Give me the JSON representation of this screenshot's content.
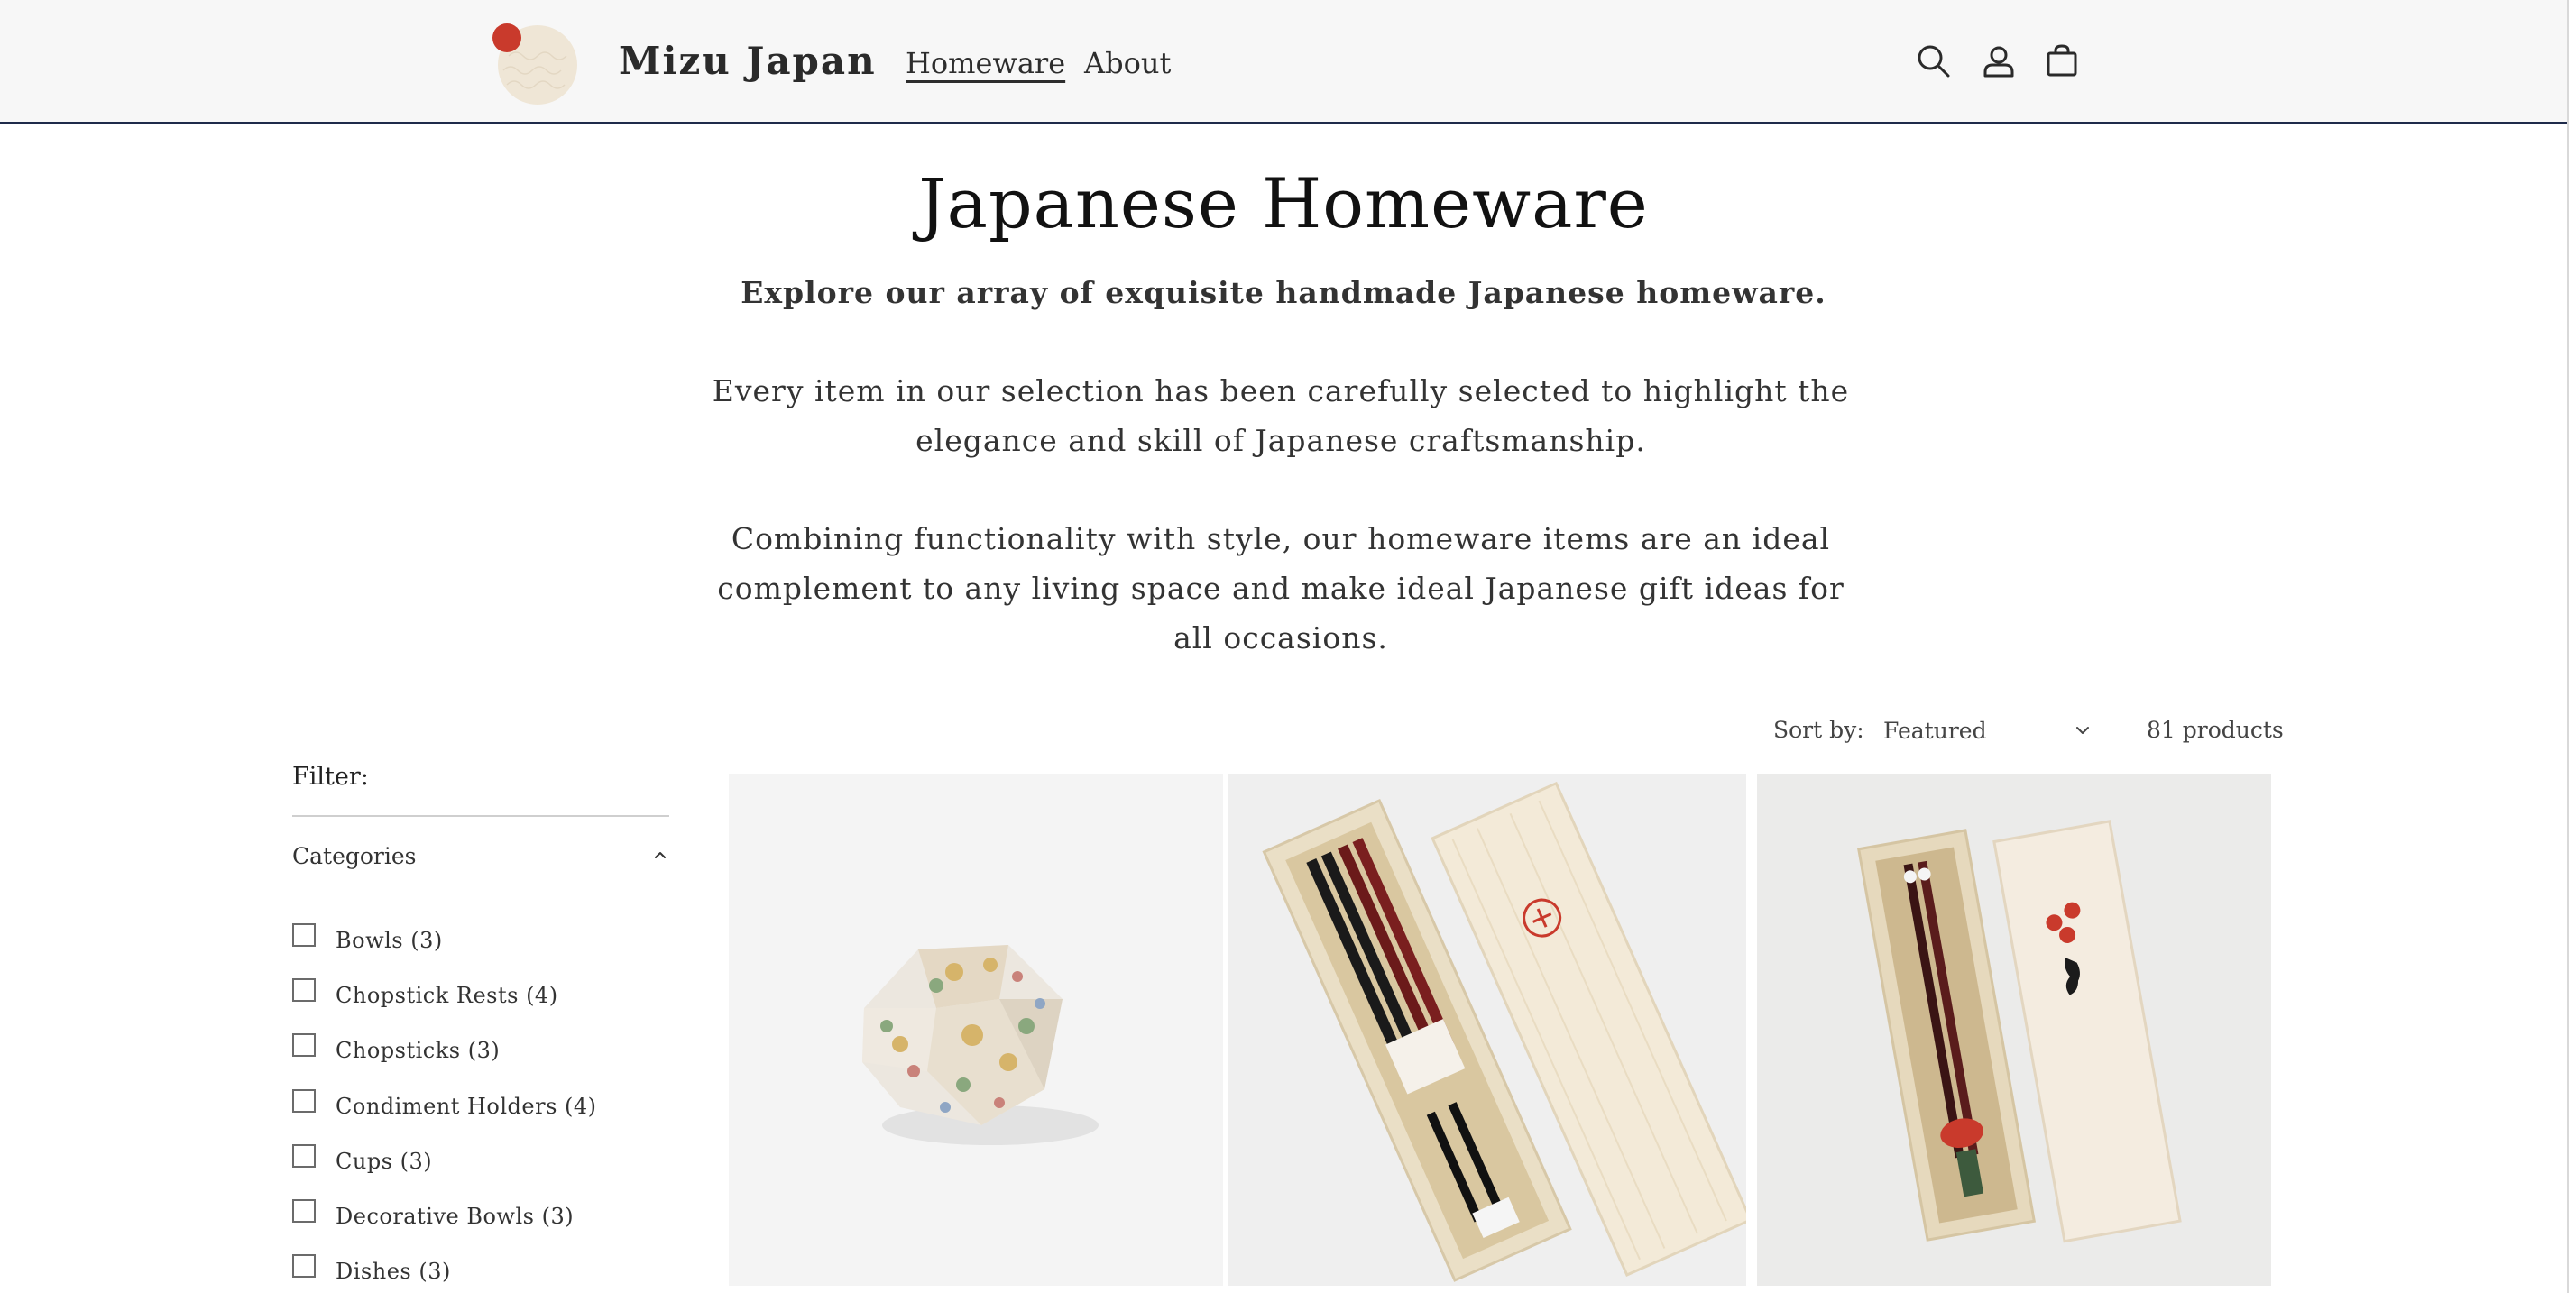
{
  "header": {
    "brand": "Mizu Japan",
    "nav": [
      {
        "label": "Homeware",
        "active": true
      },
      {
        "label": "About",
        "active": false
      }
    ],
    "icons": [
      "search-icon",
      "account-icon",
      "cart-icon"
    ],
    "accent_color": "#1e2a4a",
    "logo_dot_color": "#c93a2c"
  },
  "hero": {
    "title": "Japanese Homeware",
    "lead": "Explore our array of exquisite handmade Japanese homeware.",
    "paragraph1": "Every item in our selection has been carefully selected to highlight the elegance and skill of Japanese craftsmanship.",
    "paragraph2": "Combining functionality with style, our homeware items are an ideal complement to any living space and make ideal Japanese gift ideas for all occasions."
  },
  "sorting": {
    "label": "Sort by:",
    "selected": "Featured",
    "product_count": "81 products"
  },
  "filter": {
    "label": "Filter:",
    "group_title": "Categories",
    "categories": [
      {
        "label": "Bowls (3)",
        "checked": false
      },
      {
        "label": "Chopstick Rests (4)",
        "checked": false
      },
      {
        "label": "Chopsticks (3)",
        "checked": false
      },
      {
        "label": "Condiment Holders (4)",
        "checked": false
      },
      {
        "label": "Cups (3)",
        "checked": false
      },
      {
        "label": "Decorative Bowls (3)",
        "checked": false
      },
      {
        "label": "Dishes (3)",
        "checked": false
      }
    ]
  },
  "products": [
    {
      "image": "brocade-fabric-box"
    },
    {
      "image": "chopsticks-pair-wooden-box"
    },
    {
      "image": "cat-chopsticks-wooden-box"
    }
  ]
}
